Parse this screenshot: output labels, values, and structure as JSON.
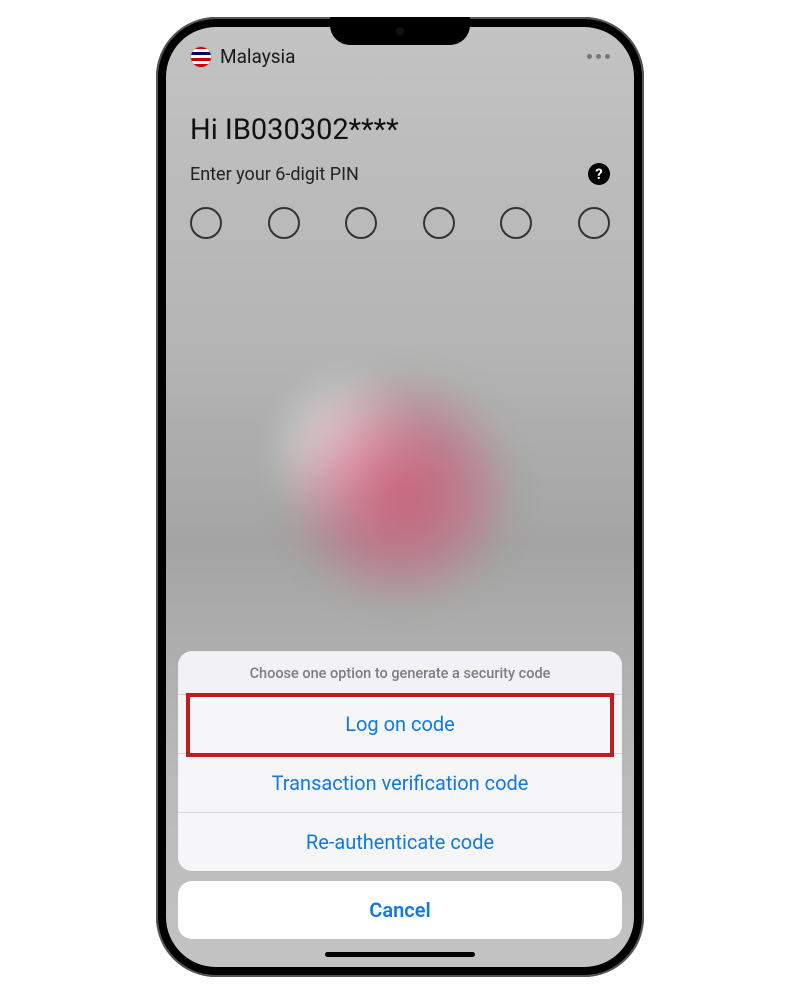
{
  "topbar": {
    "country_label": "Malaysia"
  },
  "greeting": {
    "hi_text": "Hi IB030302****",
    "enter_pin_label": "Enter your 6-digit PIN"
  },
  "action_sheet": {
    "header": "Choose one option to generate a security code",
    "option_logon": "Log on code",
    "option_txn": "Transaction verification code",
    "option_reauth": "Re-authenticate code",
    "cancel_label": "Cancel"
  },
  "colors": {
    "link_blue": "#1079e6",
    "highlight_red": "#c21b1b"
  },
  "flag_stripes": [
    "#cc0001",
    "#ffffff",
    "#cc0001",
    "#ffffff",
    "#010066",
    "#ffffff",
    "#cc0001",
    "#ffffff",
    "#cc0001"
  ]
}
